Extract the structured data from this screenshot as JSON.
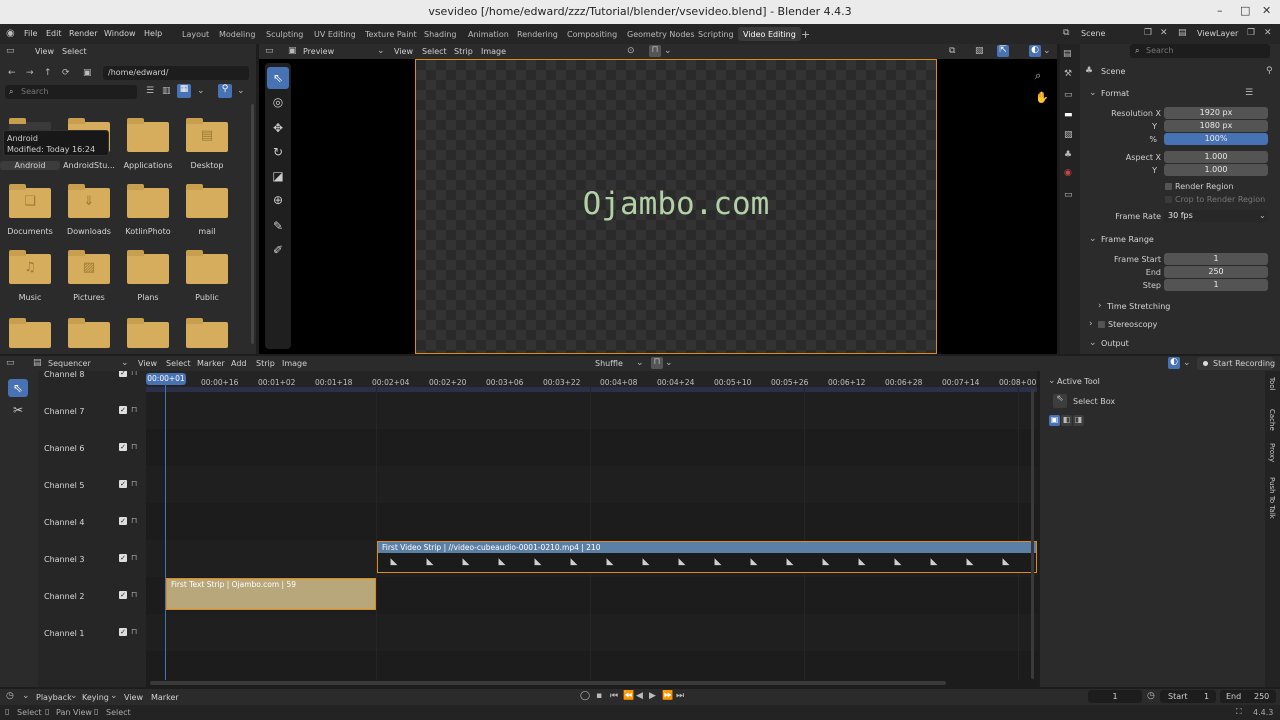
{
  "window": {
    "title": "vsevideo [/home/edward/zzz/Tutorial/blender/vsevideo.blend] - Blender 4.4.3",
    "controls": [
      "–",
      "□",
      "✕"
    ]
  },
  "menu": {
    "items": [
      "File",
      "Edit",
      "Render",
      "Window",
      "Help"
    ]
  },
  "workspaces": [
    "Layout",
    "Modeling",
    "Sculpting",
    "UV Editing",
    "Texture Paint",
    "Shading",
    "Animation",
    "Rendering",
    "Compositing",
    "Geometry Nodes",
    "Scripting",
    "Video Editing"
  ],
  "scene": {
    "scene_name": "Scene",
    "view_layer": "ViewLayer"
  },
  "file_browser": {
    "menus": [
      "View",
      "Select"
    ],
    "path": "/home/edward/",
    "search_placeholder": "Search",
    "tooltip_name": "Android",
    "tooltip_modified": "Modified: Today 16:24",
    "items": [
      {
        "label": "Android",
        "icon": "folder-icon"
      },
      {
        "label": "AndroidStu...",
        "icon": "folder-icon"
      },
      {
        "label": "Applications",
        "icon": "folder-icon"
      },
      {
        "label": "Desktop",
        "icon": "desktop-folder-icon"
      },
      {
        "label": "Documents",
        "icon": "documents-folder-icon"
      },
      {
        "label": "Downloads",
        "icon": "downloads-folder-icon"
      },
      {
        "label": "KotlinPhoto",
        "icon": "folder-icon"
      },
      {
        "label": "mail",
        "icon": "folder-icon"
      },
      {
        "label": "Music",
        "icon": "music-folder-icon"
      },
      {
        "label": "Pictures",
        "icon": "pictures-folder-icon"
      },
      {
        "label": "Plans",
        "icon": "folder-icon"
      },
      {
        "label": "Public",
        "icon": "folder-icon"
      }
    ]
  },
  "preview": {
    "mode": "Preview",
    "menus": [
      "View",
      "Select",
      "Strip",
      "Image"
    ],
    "text": "Ojambo.com"
  },
  "properties": {
    "search_placeholder": "Search",
    "scene": "Scene",
    "format_title": "Format",
    "res_x_label": "Resolution X",
    "res_x": "1920 px",
    "res_y_label": "Y",
    "res_y": "1080 px",
    "res_pct_label": "%",
    "res_pct": "100%",
    "res_pct_fill": 1.0,
    "aspect_x_label": "Aspect X",
    "aspect_x": "1.000",
    "aspect_y_label": "Y",
    "aspect_y": "1.000",
    "render_region": "Render Region",
    "crop_region": "Crop to Render Region",
    "frame_rate_label": "Frame Rate",
    "frame_rate": "30 fps",
    "frame_range_title": "Frame Range",
    "frame_start_label": "Frame Start",
    "frame_start": "1",
    "end_label": "End",
    "end": "250",
    "step_label": "Step",
    "step": "1",
    "time_stretching": "Time Stretching",
    "stereoscopy": "Stereoscopy",
    "output": "Output"
  },
  "sequencer": {
    "editor": "Sequencer",
    "menus": [
      "View",
      "Select",
      "Marker",
      "Add",
      "Strip",
      "Image"
    ],
    "snap_mode": "Shuffle",
    "record": "Start Recording",
    "current_time": "00:00+01",
    "ticks": [
      "00:00+16",
      "00:01+02",
      "00:01+18",
      "00:02+04",
      "00:02+20",
      "00:03+06",
      "00:03+22",
      "00:04+08",
      "00:04+24",
      "00:05+10",
      "00:05+26",
      "00:06+12",
      "00:06+28",
      "00:07+14",
      "00:08+00"
    ],
    "channels": [
      "Channel 8",
      "Channel 7",
      "Channel 6",
      "Channel 5",
      "Channel 4",
      "Channel 3",
      "Channel 2",
      "Channel 1"
    ],
    "video_strip": "First Video Strip | //video-cubeaudio-0001-0210.mp4 | 210",
    "text_strip": "First Text Strip | Ojambo.com | 59",
    "active_tool_title": "Active Tool",
    "active_tool": "Select Box",
    "side_tabs": [
      "Tool",
      "Cache",
      "Proxy",
      "Push To Talk"
    ]
  },
  "timeline": {
    "menus": [
      "Playback",
      "Keying",
      "View",
      "Marker"
    ],
    "current_frame": "1",
    "start_label": "Start",
    "start": "1",
    "end_label": "End",
    "end": "250"
  },
  "statusbar": {
    "items": [
      "Select",
      "Pan View",
      "Select"
    ],
    "version": "4.4.3"
  }
}
